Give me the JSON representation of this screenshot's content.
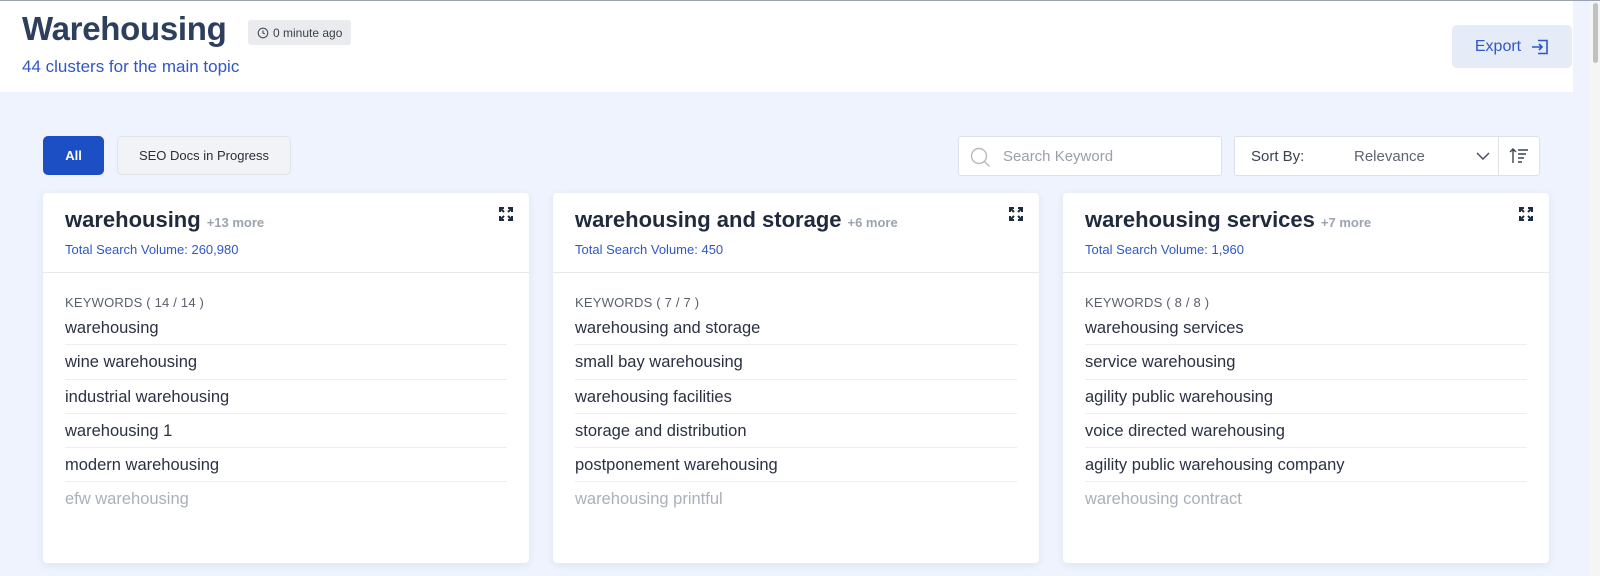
{
  "header": {
    "title": "Warehousing",
    "updated": "0 minute ago",
    "subtitle": "44 clusters for the main topic",
    "export_label": "Export"
  },
  "filters": {
    "all_label": "All",
    "seo_label": "SEO Docs in Progress",
    "search_placeholder": "Search Keyword",
    "sort_label": "Sort By:",
    "sort_value": "Relevance"
  },
  "colors": {
    "accent": "#1d4fc4",
    "link": "#2f57c7",
    "background": "#eef3fd"
  },
  "clusters": [
    {
      "title": "warehousing",
      "more": "+13 more",
      "volume": "Total Search Volume: 260,980",
      "keywords_label": "KEYWORDS ( 14 / 14 )",
      "keywords": [
        "warehousing",
        "wine warehousing",
        "industrial warehousing",
        "warehousing 1",
        "modern warehousing",
        "efw warehousing"
      ]
    },
    {
      "title": "warehousing and storage",
      "more": "+6 more",
      "volume": "Total Search Volume: 450",
      "keywords_label": "KEYWORDS ( 7 / 7 )",
      "keywords": [
        "warehousing and storage",
        "small bay warehousing",
        "warehousing facilities",
        "storage and distribution",
        "postponement warehousing",
        "warehousing printful"
      ]
    },
    {
      "title": "warehousing services",
      "more": "+7 more",
      "volume": "Total Search Volume: 1,960",
      "keywords_label": "KEYWORDS ( 8 / 8 )",
      "keywords": [
        "warehousing services",
        "service warehousing",
        "agility public warehousing",
        "voice directed warehousing",
        "agility public warehousing company",
        "warehousing contract"
      ]
    }
  ]
}
